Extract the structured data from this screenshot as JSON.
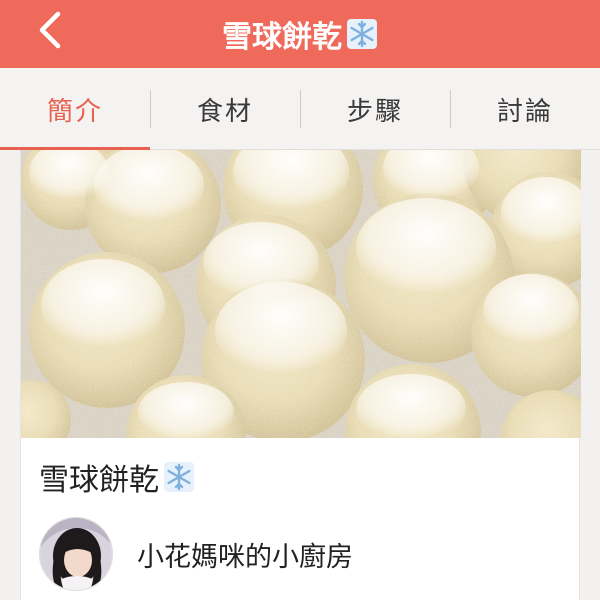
{
  "header": {
    "title": "雪球餅乾",
    "back_icon": "chevron-left-icon",
    "title_icon": "snowflake-icon"
  },
  "tabs": [
    {
      "label": "簡介",
      "active": true
    },
    {
      "label": "食材",
      "active": false
    },
    {
      "label": "步驟",
      "active": false
    },
    {
      "label": "討論",
      "active": false
    }
  ],
  "recipe": {
    "title": "雪球餅乾",
    "title_icon": "snowflake-icon",
    "author_name": "小花媽咪的小廚房"
  },
  "colors": {
    "accent": "#f06a5b",
    "active_tab": "#e8604f",
    "snowflake": "#8ab6e0"
  }
}
